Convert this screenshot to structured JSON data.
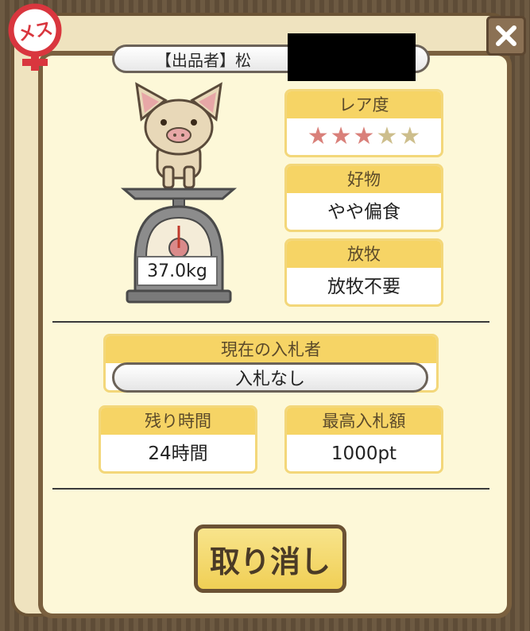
{
  "badge": {
    "text": "メス",
    "icon": "female-symbol-icon"
  },
  "close_icon": "close-icon",
  "seller": {
    "label": "【出品者】松"
  },
  "weight": "37.0kg",
  "rarity": {
    "header": "レア度",
    "stars_filled": 3,
    "stars_total": 5
  },
  "favorite": {
    "header": "好物",
    "value": "やや偏食"
  },
  "grazing": {
    "header": "放牧",
    "value": "放牧不要"
  },
  "bidder": {
    "header": "現在の入札者",
    "value": "入札なし"
  },
  "time_left": {
    "header": "残り時間",
    "value": "24時間"
  },
  "max_bid": {
    "header": "最高入札額",
    "value": "1000pt"
  },
  "cancel_button": "取り消し",
  "colors": {
    "accent": "#f6d465",
    "star_on": "#d9807a",
    "star_off": "#cdbe8c",
    "badge": "#d9363e"
  }
}
